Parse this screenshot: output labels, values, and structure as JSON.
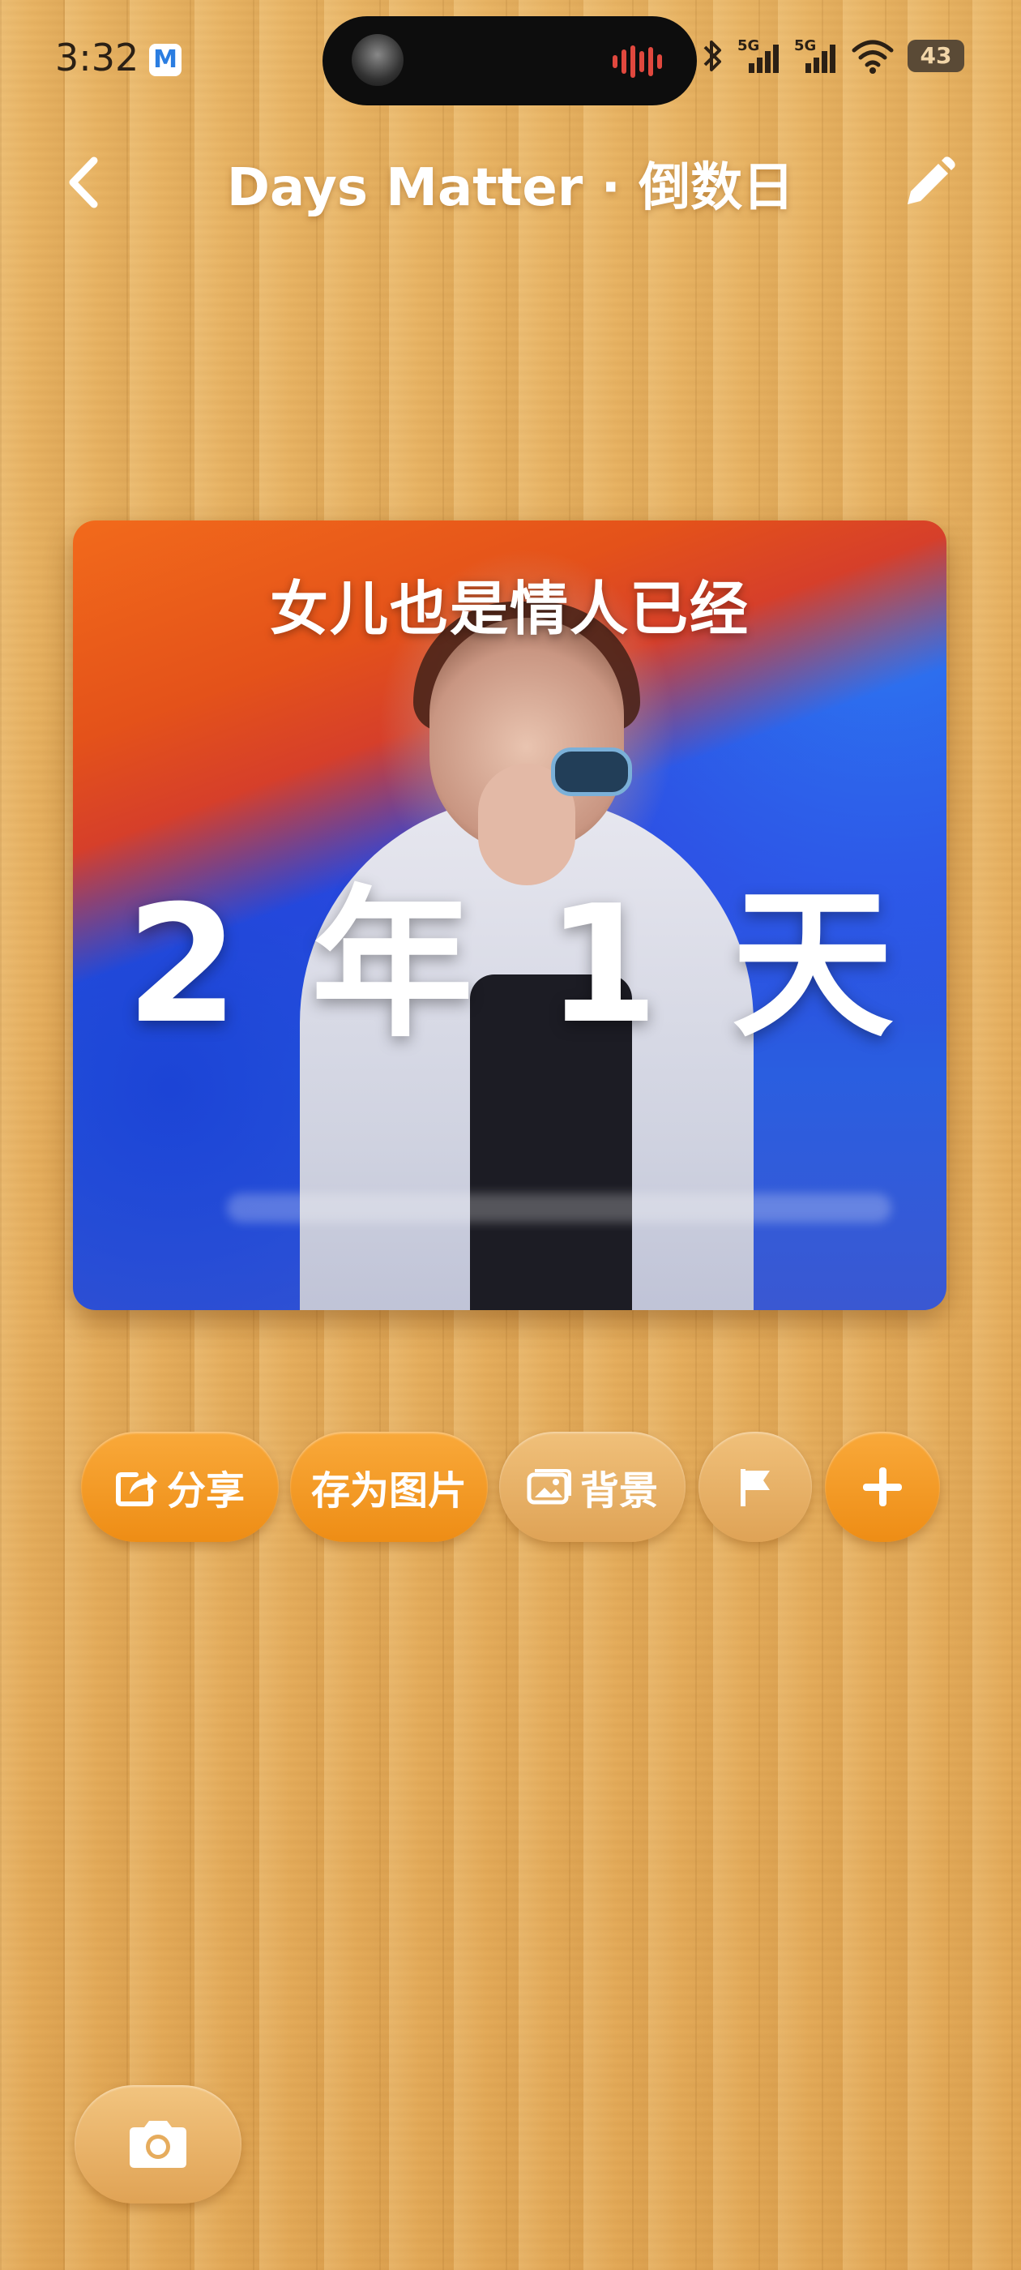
{
  "status_bar": {
    "time": "3:32",
    "mail_app_letter": "M",
    "network_1": "5G",
    "network_2": "5G",
    "battery": "43"
  },
  "header": {
    "title": "Days Matter · 倒数日",
    "back_icon": "chevron-left-icon",
    "edit_icon": "pencil-icon"
  },
  "card": {
    "caption": "女儿也是情人已经",
    "duration_text": "2 年 1 天",
    "years": 2,
    "days": 1
  },
  "actions": {
    "share_label": "分享",
    "save_image_label": "存为图片",
    "background_label": "背景",
    "flag_icon": "flag-icon",
    "add_icon": "plus-icon"
  },
  "bottom": {
    "camera_icon": "camera-icon"
  },
  "colors": {
    "wood": "#e7b161",
    "accent_orange": "#ee8d15",
    "pill_tan": "#dfa356",
    "text_white": "#ffffff"
  }
}
